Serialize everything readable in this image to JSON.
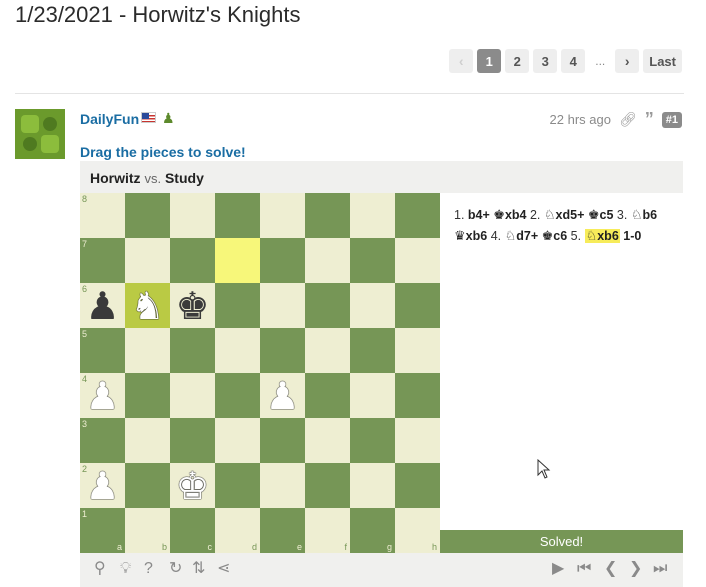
{
  "page": {
    "title": "1/23/2021 - Horwitz's Knights"
  },
  "pagination": {
    "prev_icon": "chevron-left-icon",
    "pages": [
      "1",
      "2",
      "3",
      "4"
    ],
    "active_page": "1",
    "ellipsis": "...",
    "next_icon": "chevron-right-icon",
    "last_label": "Last"
  },
  "post": {
    "username": "DailyFun",
    "flag_icon": "us-flag-icon",
    "membership_icon": "pawn-icon",
    "timestamp": "22 hrs ago",
    "link_icon": "link-icon",
    "quote_icon": "quote-icon",
    "post_number": "#1",
    "instruction": "Drag the pieces to solve!"
  },
  "puzzle": {
    "white_player": "Horwitz",
    "vs_label": "vs.",
    "black_player": "Study",
    "ranks": [
      "8",
      "7",
      "6",
      "5",
      "4",
      "3",
      "2",
      "1"
    ],
    "files": [
      "a",
      "b",
      "c",
      "d",
      "e",
      "f",
      "g",
      "h"
    ],
    "pieces": [
      {
        "square": "a6",
        "glyph": "♟",
        "color": "black",
        "name": "black-pawn-a6"
      },
      {
        "square": "b6",
        "glyph": "♞",
        "color": "white",
        "name": "white-knight-b6"
      },
      {
        "square": "c6",
        "glyph": "♚",
        "color": "black",
        "name": "black-king-c6"
      },
      {
        "square": "a4",
        "glyph": "♟",
        "color": "white",
        "name": "white-pawn-a4"
      },
      {
        "square": "e4",
        "glyph": "♟",
        "color": "white",
        "name": "white-pawn-e4"
      },
      {
        "square": "a2",
        "glyph": "♟",
        "color": "white",
        "name": "white-pawn-a2"
      },
      {
        "square": "c2",
        "glyph": "♚",
        "color": "white",
        "name": "white-king-c2"
      }
    ],
    "highlight_squares": [
      "d7",
      "b6"
    ],
    "moves": [
      {
        "num": "1.",
        "white": {
          "fig": "",
          "san": "b4+"
        },
        "black": {
          "fig": "♚",
          "san": "xb4"
        }
      },
      {
        "num": "2.",
        "white": {
          "fig": "♘",
          "san": "xd5+"
        },
        "black": {
          "fig": "♚",
          "san": "c5"
        }
      },
      {
        "num": "3.",
        "white": {
          "fig": "♘",
          "san": "b6"
        },
        "black": {
          "fig": "♛",
          "san": "xb6"
        }
      },
      {
        "num": "4.",
        "white": {
          "fig": "♘",
          "san": "d7+"
        },
        "black": {
          "fig": "♚",
          "san": "c6"
        }
      },
      {
        "num": "5.",
        "white": {
          "fig": "♘",
          "san": "xb6"
        },
        "black": null
      }
    ],
    "result": "1-0",
    "status": "Solved!"
  },
  "controls": {
    "left": [
      "analysis-icon",
      "hint-icon",
      "help-icon",
      "reset-icon",
      "flip-board-icon",
      "share-icon"
    ],
    "right": [
      "play-icon",
      "first-move-icon",
      "previous-move-icon",
      "next-move-icon",
      "last-move-icon"
    ]
  },
  "colors": {
    "light_square": "#eeeed2",
    "dark_square": "#769656",
    "highlight_light": "#f7f77a",
    "highlight_dark": "#baca44",
    "link_blue": "#1a6da3",
    "solved_bar": "#769656",
    "final_move_highlight": "#f7ec5a"
  }
}
